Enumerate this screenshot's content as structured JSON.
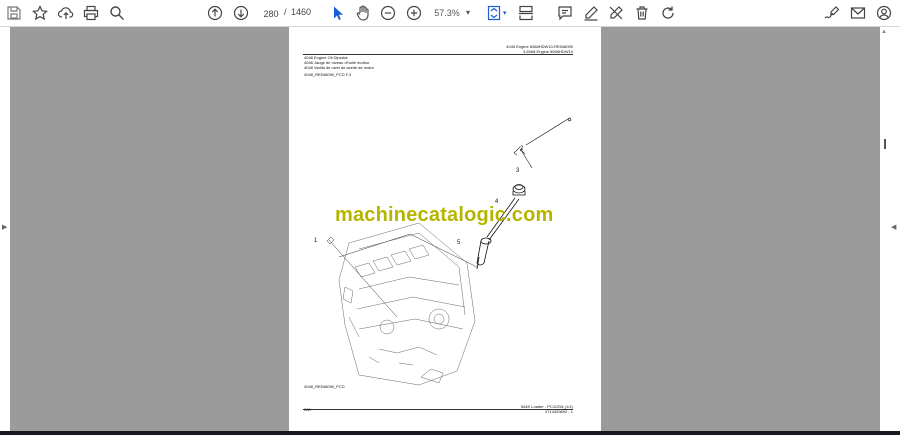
{
  "toolbar": {
    "page_current": "280",
    "page_separator": "/",
    "page_total": "1460",
    "zoom": "57.3%",
    "icons": [
      "save-icon",
      "bookmark-star-icon",
      "upload-cloud-icon",
      "print-icon",
      "zoom-find-icon",
      "page-up-icon",
      "page-down-icon",
      "select-cursor-icon",
      "hand-tool-icon",
      "zoom-out-icon",
      "zoom-in-icon",
      "fit-page-icon",
      "scroll-mode-icon",
      "comment-icon",
      "highlight-pen-icon",
      "erase-pen-icon",
      "delete-icon",
      "rotate-icon",
      "sign-icon",
      "email-icon",
      "account-icon"
    ]
  },
  "document": {
    "header_right_1": "4045 Engine 6068HDW10-RE548090",
    "header_right_2": "3-6068 Engine 6068HDW10",
    "header_left_1": "4048 Engine Oil Dipstick",
    "header_left_2": "4048 Jauge de niveau d'huile moteur",
    "header_left_3": "4048 Varilla de nivel de aceite de motor",
    "ref_code": "4048_RE548090_PCD F.3",
    "watermark": "machinecatalogic.com",
    "callouts": [
      "1",
      "2",
      "3",
      "4",
      "5"
    ],
    "figure_label": "4048_RE548090_PCD",
    "footer_left": "280",
    "footer_right_1": "544K Loader - PC11254 (1/1)",
    "footer_right_2": "4714420692 - 1"
  }
}
